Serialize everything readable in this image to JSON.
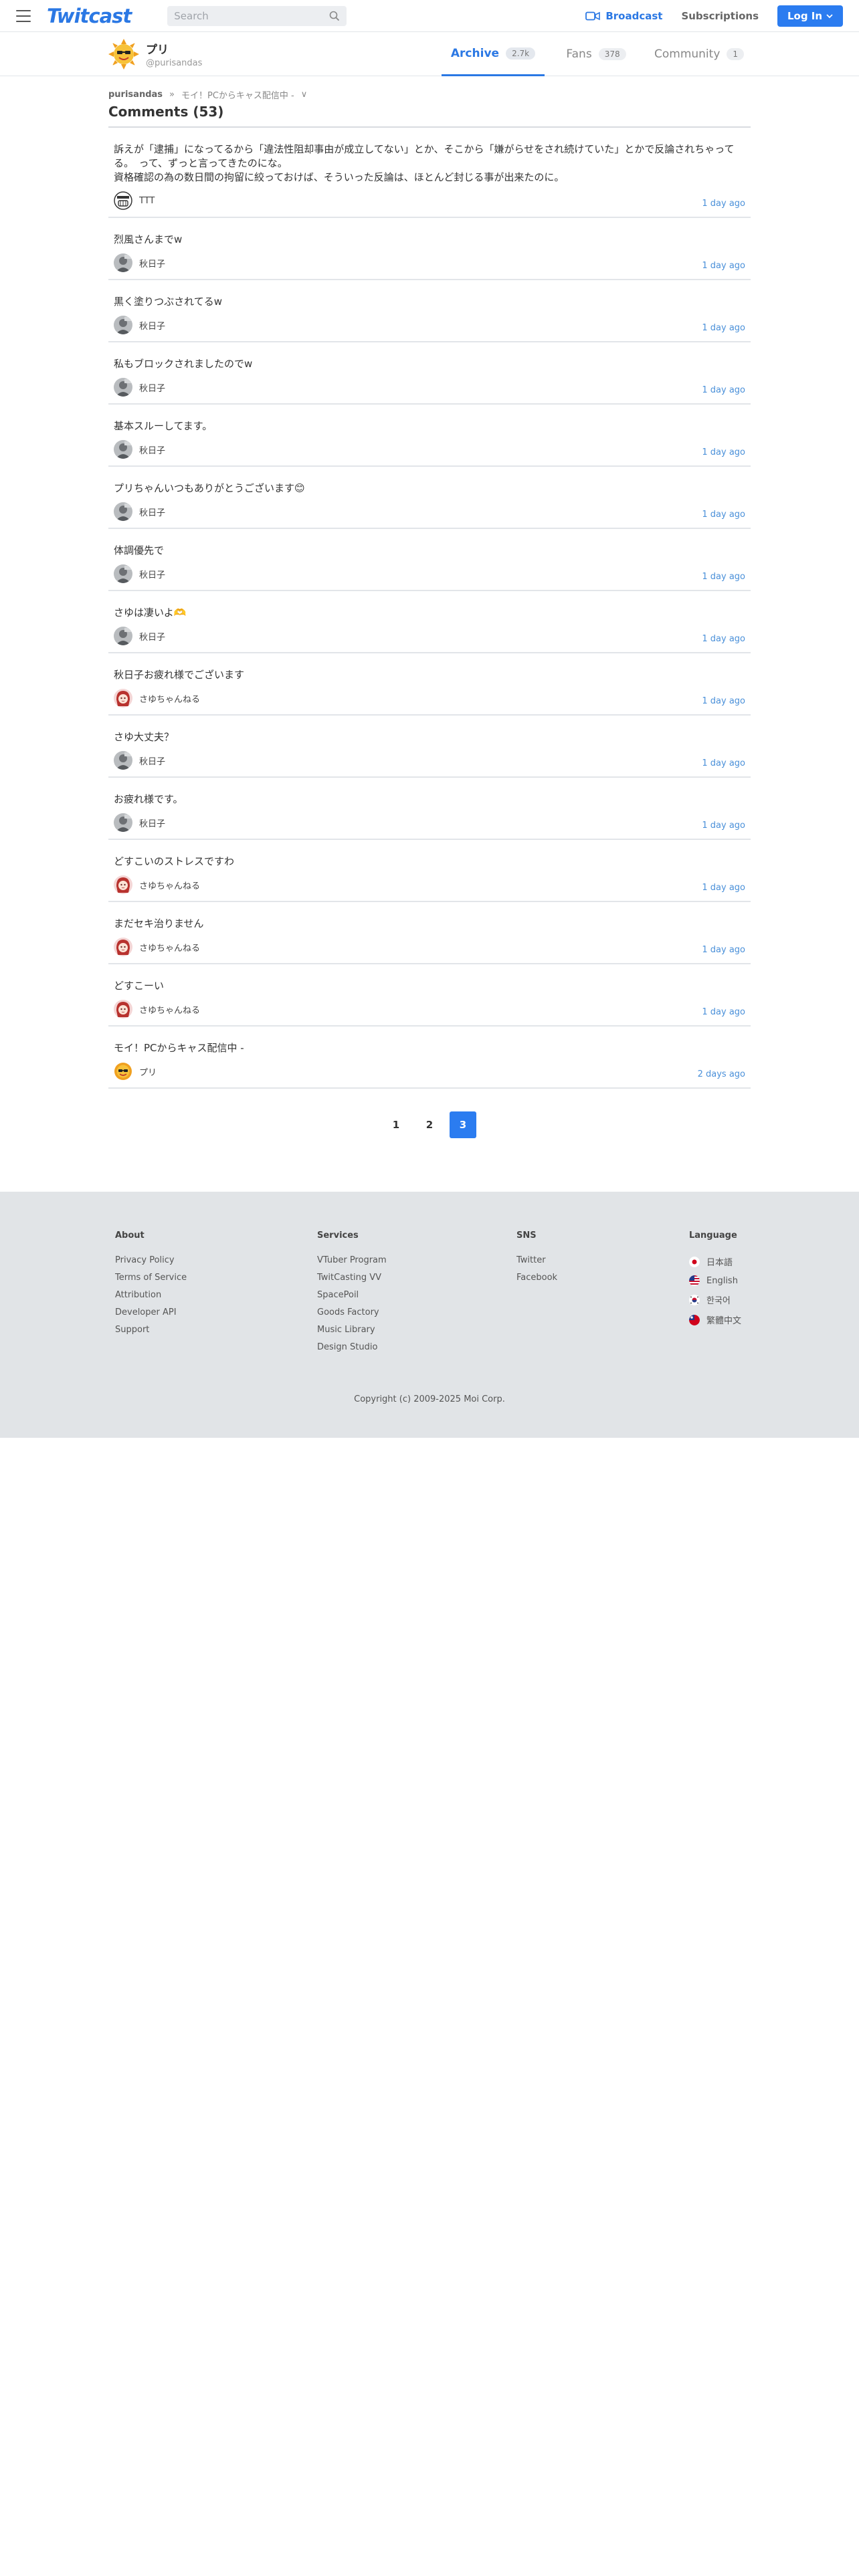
{
  "header": {
    "logo": "Twitcast",
    "search_placeholder": "Search",
    "broadcast_label": "Broadcast",
    "subscriptions_label": "Subscriptions",
    "login_label": "Log In",
    "accent": "#2b78e4"
  },
  "profile": {
    "name": "プリ",
    "handle": "@purisandas",
    "tabs": [
      {
        "label": "Archive",
        "count": "2.7k",
        "active": true
      },
      {
        "label": "Fans",
        "count": "378",
        "active": false
      },
      {
        "label": "Community",
        "count": "1",
        "active": false
      }
    ]
  },
  "breadcrumb": {
    "user": "purisandas",
    "sep": "»",
    "item": "モイ！PCからキャス配信中 -",
    "chevron": "∨"
  },
  "section_title": "Comments (53)",
  "comments": [
    {
      "text": "訴えが「逮捕」になってるから「違法性阻却事由が成立してない」とか、そこから「嫌がらせをされ続けていた」とかで反論されちゃってる。　って、ずっと言ってきたのにな。\n資格確認の為の数日間の拘留に絞っておけば、そういった反論は、ほとんど封じる事が出来たのに。",
      "author": "TTT",
      "time": "1 day ago",
      "avatar": "ttt"
    },
    {
      "text": "烈風さんまでw",
      "author": "秋日子",
      "time": "1 day ago",
      "avatar": "gray"
    },
    {
      "text": "黒く塗りつぶされてるw",
      "author": "秋日子",
      "time": "1 day ago",
      "avatar": "gray"
    },
    {
      "text": "私もブロックされましたのでw",
      "author": "秋日子",
      "time": "1 day ago",
      "avatar": "gray"
    },
    {
      "text": "基本スルーしてます。",
      "author": "秋日子",
      "time": "1 day ago",
      "avatar": "gray"
    },
    {
      "text": "プリちゃんいつもありがとうございます😊",
      "author": "秋日子",
      "time": "1 day ago",
      "avatar": "gray"
    },
    {
      "text": "体調優先で",
      "author": "秋日子",
      "time": "1 day ago",
      "avatar": "gray"
    },
    {
      "text": "さゆは凄いよ🫶",
      "author": "秋日子",
      "time": "1 day ago",
      "avatar": "gray"
    },
    {
      "text": "秋日子お疲れ様でございます",
      "author": "さゆちゃんねる",
      "time": "1 day ago",
      "avatar": "pink"
    },
    {
      "text": "さゆ大丈夫？",
      "author": "秋日子",
      "time": "1 day ago",
      "avatar": "gray"
    },
    {
      "text": "お疲れ様です。",
      "author": "秋日子",
      "time": "1 day ago",
      "avatar": "gray"
    },
    {
      "text": "どすこいのストレスですわ",
      "author": "さゆちゃんねる",
      "time": "1 day ago",
      "avatar": "pink"
    },
    {
      "text": "まだセキ治りません",
      "author": "さゆちゃんねる",
      "time": "1 day ago",
      "avatar": "pink"
    },
    {
      "text": "どすこーい",
      "author": "さゆちゃんねる",
      "time": "1 day ago",
      "avatar": "pink"
    },
    {
      "text": "モイ！PCからキャス配信中 -",
      "author": "プリ",
      "time": "2 days ago",
      "avatar": "sun"
    }
  ],
  "pagination": {
    "pages": [
      "1",
      "2",
      "3"
    ],
    "current": "3"
  },
  "footer": {
    "about": {
      "title": "About",
      "links": [
        "Privacy Policy",
        "Terms of Service",
        "Attribution",
        "Developer API",
        "Support"
      ]
    },
    "services": {
      "title": "Services",
      "links": [
        "VTuber Program",
        "TwitCasting VV",
        "SpacePoil",
        "Goods Factory",
        "Music Library",
        "Design Studio"
      ]
    },
    "sns": {
      "title": "SNS",
      "links": [
        "Twitter",
        "Facebook"
      ]
    },
    "language": {
      "title": "Language",
      "items": [
        {
          "label": "日本語",
          "flag": "jp"
        },
        {
          "label": "English",
          "flag": "us"
        },
        {
          "label": "한국어",
          "flag": "kr"
        },
        {
          "label": "繁體中文",
          "flag": "tw"
        }
      ]
    },
    "copyright": "Copyright (c) 2009-2025 Moi Corp."
  }
}
